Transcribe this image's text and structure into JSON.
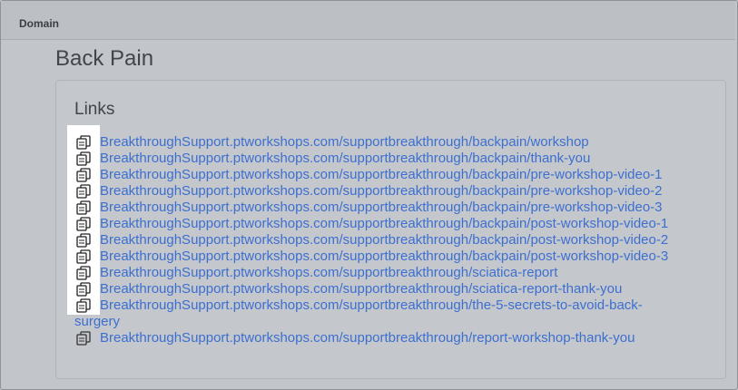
{
  "header": {
    "domain_label": "Domain"
  },
  "section": {
    "title": "Back Pain"
  },
  "links_panel": {
    "heading": "Links",
    "icon": "copy-icon",
    "items": [
      {
        "url": "BreakthroughSupport.ptworkshops.com/supportbreakthrough/backpain/workshop"
      },
      {
        "url": "BreakthroughSupport.ptworkshops.com/supportbreakthrough/backpain/thank-you"
      },
      {
        "url": "BreakthroughSupport.ptworkshops.com/supportbreakthrough/backpain/pre-workshop-video-1"
      },
      {
        "url": "BreakthroughSupport.ptworkshops.com/supportbreakthrough/backpain/pre-workshop-video-2"
      },
      {
        "url": "BreakthroughSupport.ptworkshops.com/supportbreakthrough/backpain/pre-workshop-video-3"
      },
      {
        "url": "BreakthroughSupport.ptworkshops.com/supportbreakthrough/backpain/post-workshop-video-1"
      },
      {
        "url": "BreakthroughSupport.ptworkshops.com/supportbreakthrough/backpain/post-workshop-video-2"
      },
      {
        "url": "BreakthroughSupport.ptworkshops.com/supportbreakthrough/backpain/post-workshop-video-3"
      },
      {
        "url": "BreakthroughSupport.ptworkshops.com/supportbreakthrough/sciatica-report"
      },
      {
        "url": "BreakthroughSupport.ptworkshops.com/supportbreakthrough/sciatica-report-thank-you"
      },
      {
        "url_line1": "BreakthroughSupport.ptworkshops.com/supportbreakthrough/the-5-secrets-to-avoid-back-",
        "url_line2": "surgery"
      },
      {
        "url": "BreakthroughSupport.ptworkshops.com/supportbreakthrough/report-workshop-thank-you"
      }
    ]
  },
  "colors": {
    "link": "#3d6fd0",
    "highlight": "#ffffff",
    "backdrop": "#c2c5c9"
  }
}
